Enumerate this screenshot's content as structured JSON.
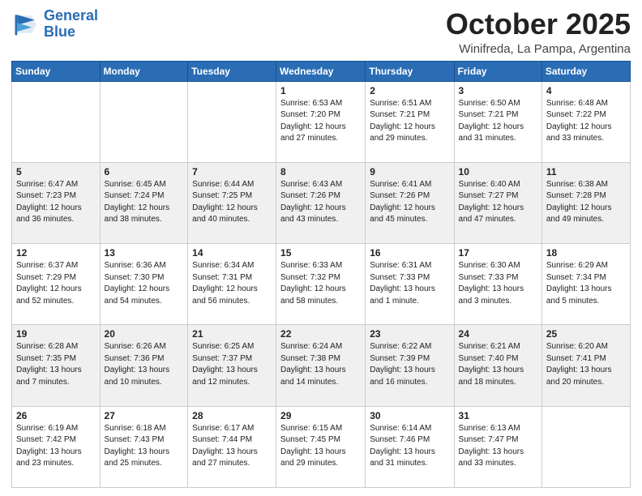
{
  "header": {
    "logo_line1": "General",
    "logo_line2": "Blue",
    "month": "October 2025",
    "location": "Winifreda, La Pampa, Argentina"
  },
  "weekdays": [
    "Sunday",
    "Monday",
    "Tuesday",
    "Wednesday",
    "Thursday",
    "Friday",
    "Saturday"
  ],
  "weeks": [
    [
      {
        "day": "",
        "info": ""
      },
      {
        "day": "",
        "info": ""
      },
      {
        "day": "",
        "info": ""
      },
      {
        "day": "1",
        "info": "Sunrise: 6:53 AM\nSunset: 7:20 PM\nDaylight: 12 hours\nand 27 minutes."
      },
      {
        "day": "2",
        "info": "Sunrise: 6:51 AM\nSunset: 7:21 PM\nDaylight: 12 hours\nand 29 minutes."
      },
      {
        "day": "3",
        "info": "Sunrise: 6:50 AM\nSunset: 7:21 PM\nDaylight: 12 hours\nand 31 minutes."
      },
      {
        "day": "4",
        "info": "Sunrise: 6:48 AM\nSunset: 7:22 PM\nDaylight: 12 hours\nand 33 minutes."
      }
    ],
    [
      {
        "day": "5",
        "info": "Sunrise: 6:47 AM\nSunset: 7:23 PM\nDaylight: 12 hours\nand 36 minutes."
      },
      {
        "day": "6",
        "info": "Sunrise: 6:45 AM\nSunset: 7:24 PM\nDaylight: 12 hours\nand 38 minutes."
      },
      {
        "day": "7",
        "info": "Sunrise: 6:44 AM\nSunset: 7:25 PM\nDaylight: 12 hours\nand 40 minutes."
      },
      {
        "day": "8",
        "info": "Sunrise: 6:43 AM\nSunset: 7:26 PM\nDaylight: 12 hours\nand 43 minutes."
      },
      {
        "day": "9",
        "info": "Sunrise: 6:41 AM\nSunset: 7:26 PM\nDaylight: 12 hours\nand 45 minutes."
      },
      {
        "day": "10",
        "info": "Sunrise: 6:40 AM\nSunset: 7:27 PM\nDaylight: 12 hours\nand 47 minutes."
      },
      {
        "day": "11",
        "info": "Sunrise: 6:38 AM\nSunset: 7:28 PM\nDaylight: 12 hours\nand 49 minutes."
      }
    ],
    [
      {
        "day": "12",
        "info": "Sunrise: 6:37 AM\nSunset: 7:29 PM\nDaylight: 12 hours\nand 52 minutes."
      },
      {
        "day": "13",
        "info": "Sunrise: 6:36 AM\nSunset: 7:30 PM\nDaylight: 12 hours\nand 54 minutes."
      },
      {
        "day": "14",
        "info": "Sunrise: 6:34 AM\nSunset: 7:31 PM\nDaylight: 12 hours\nand 56 minutes."
      },
      {
        "day": "15",
        "info": "Sunrise: 6:33 AM\nSunset: 7:32 PM\nDaylight: 12 hours\nand 58 minutes."
      },
      {
        "day": "16",
        "info": "Sunrise: 6:31 AM\nSunset: 7:33 PM\nDaylight: 13 hours\nand 1 minute."
      },
      {
        "day": "17",
        "info": "Sunrise: 6:30 AM\nSunset: 7:33 PM\nDaylight: 13 hours\nand 3 minutes."
      },
      {
        "day": "18",
        "info": "Sunrise: 6:29 AM\nSunset: 7:34 PM\nDaylight: 13 hours\nand 5 minutes."
      }
    ],
    [
      {
        "day": "19",
        "info": "Sunrise: 6:28 AM\nSunset: 7:35 PM\nDaylight: 13 hours\nand 7 minutes."
      },
      {
        "day": "20",
        "info": "Sunrise: 6:26 AM\nSunset: 7:36 PM\nDaylight: 13 hours\nand 10 minutes."
      },
      {
        "day": "21",
        "info": "Sunrise: 6:25 AM\nSunset: 7:37 PM\nDaylight: 13 hours\nand 12 minutes."
      },
      {
        "day": "22",
        "info": "Sunrise: 6:24 AM\nSunset: 7:38 PM\nDaylight: 13 hours\nand 14 minutes."
      },
      {
        "day": "23",
        "info": "Sunrise: 6:22 AM\nSunset: 7:39 PM\nDaylight: 13 hours\nand 16 minutes."
      },
      {
        "day": "24",
        "info": "Sunrise: 6:21 AM\nSunset: 7:40 PM\nDaylight: 13 hours\nand 18 minutes."
      },
      {
        "day": "25",
        "info": "Sunrise: 6:20 AM\nSunset: 7:41 PM\nDaylight: 13 hours\nand 20 minutes."
      }
    ],
    [
      {
        "day": "26",
        "info": "Sunrise: 6:19 AM\nSunset: 7:42 PM\nDaylight: 13 hours\nand 23 minutes."
      },
      {
        "day": "27",
        "info": "Sunrise: 6:18 AM\nSunset: 7:43 PM\nDaylight: 13 hours\nand 25 minutes."
      },
      {
        "day": "28",
        "info": "Sunrise: 6:17 AM\nSunset: 7:44 PM\nDaylight: 13 hours\nand 27 minutes."
      },
      {
        "day": "29",
        "info": "Sunrise: 6:15 AM\nSunset: 7:45 PM\nDaylight: 13 hours\nand 29 minutes."
      },
      {
        "day": "30",
        "info": "Sunrise: 6:14 AM\nSunset: 7:46 PM\nDaylight: 13 hours\nand 31 minutes."
      },
      {
        "day": "31",
        "info": "Sunrise: 6:13 AM\nSunset: 7:47 PM\nDaylight: 13 hours\nand 33 minutes."
      },
      {
        "day": "",
        "info": ""
      }
    ]
  ]
}
